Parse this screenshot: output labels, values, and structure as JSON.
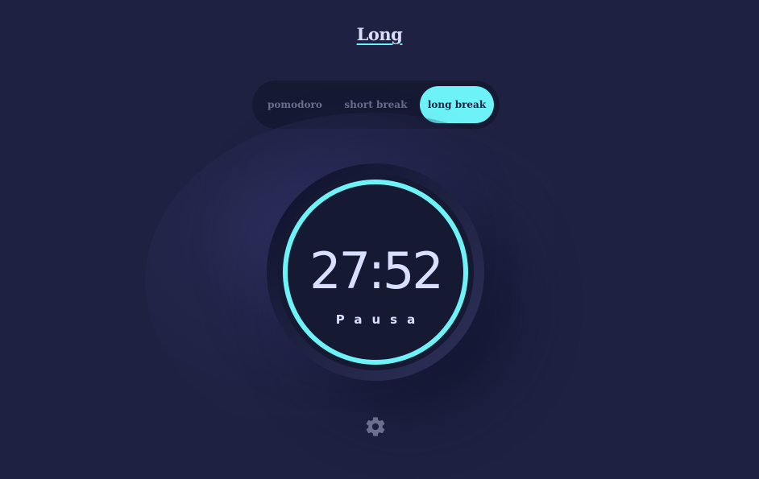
{
  "header": {
    "title": "Long"
  },
  "tabs": [
    {
      "label": "pomodoro",
      "active": false
    },
    {
      "label": "short break",
      "active": false
    },
    {
      "label": "long break",
      "active": true
    }
  ],
  "timer": {
    "time": "27:52",
    "action_label": "Pausa"
  },
  "icons": {
    "settings": "gear-icon"
  },
  "colors": {
    "background": "#1f2142",
    "panel": "#161932",
    "accent": "#6df2f7",
    "text": "#d7e0ff",
    "muted_text": "#6b6f8d"
  }
}
